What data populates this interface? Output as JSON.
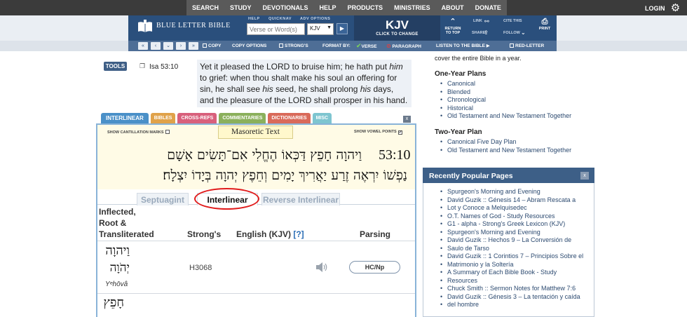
{
  "topnav": {
    "links": [
      "SEARCH",
      "STUDY",
      "DEVOTIONALS",
      "HELP",
      "PRODUCTS",
      "MINISTRIES",
      "ABOUT",
      "DONATE"
    ],
    "login": "LOGIN"
  },
  "header": {
    "logo": "BLUE LETTER BIBLE",
    "help_label": "HELP",
    "quicknav_label": "QUICKNAV",
    "adv_options_label": "ADV OPTIONS",
    "search_placeholder": "Verse or Word(s)",
    "version_selected": "KJV",
    "current_version": "KJV",
    "click_to_change": "CLICK TO CHANGE",
    "return_to_top": "RETURN TO TOP",
    "link_label": "LINK",
    "share_label": "SHARE",
    "cite_this": "CITE THIS",
    "follow_label": "FOLLOW",
    "print_label": "PRINT"
  },
  "toolstrip": {
    "copy": "COPY",
    "copy_options": "COPY OPTIONS",
    "strongs": "STRONG'S",
    "format_by": "FORMAT BY:",
    "verse": "VERSE",
    "paragraph": "PARAGRAPH",
    "listen": "LISTEN TO THE BIBLE",
    "red_letter": "RED-LETTER"
  },
  "verse": {
    "tools_label": "TOOLS",
    "reference": "Isa 53:10",
    "text_part1": "Yet it pleased the LORD to bruise him; he hath put ",
    "text_him": "him",
    "text_part2": " to grief: when thou shalt make his soul an offering for sin, he shall see ",
    "text_his1": "his",
    "text_part3": " seed, he shall prolong ",
    "text_his2": "his",
    "text_part4": " days, and the pleasure of the LORD shall prosper in his hand."
  },
  "tabs": [
    {
      "label": "INTERLINEAR",
      "color": "#4a90c8"
    },
    {
      "label": "BIBLES",
      "color": "#e0a24a"
    },
    {
      "label": "CROSS-REFS",
      "color": "#d8607c"
    },
    {
      "label": "COMMENTARIES",
      "color": "#8bb05c"
    },
    {
      "label": "DICTIONARIES",
      "color": "#d96a5a"
    },
    {
      "label": "MISC",
      "color": "#7ec5d0"
    }
  ],
  "panel": {
    "close": "x",
    "show_cantillation": "SHOW CANTILLATION MARKS",
    "show_vowel": "SHOW VOWEL POINTS",
    "masoretic_label": "Masoretic Text",
    "verse_number": "53:10",
    "hebrew_line1": "וַיהוָה חָפֵץ דַּכְּאוֹ הֶחֱלִי אִם־תָּשִׂים אָשָׁם",
    "hebrew_line2": "נַפְשׁוֹ יִרְאֶה זֶרַע יַאֲרִיךְ יָמִים וְחֵפֶץ יְהוָה בְּיָדוֹ יִצְלָח׃",
    "subtabs": [
      "Septuagint",
      "Interlinear",
      "Reverse Interlinear"
    ],
    "col_inflected": "Inflected,",
    "col_root": "Root &",
    "col_translit": "Transliterated",
    "col_strongs": "Strong's",
    "col_english": "English (KJV)",
    "col_help": "[?]",
    "col_parsing": "Parsing",
    "row1_inflected": "וַיהוָה",
    "row1_root": "יְהֹוָה",
    "row1_translit": "Yᵉhōvâ",
    "row1_strongs": "H3068",
    "row1_parsing": "HC/Np",
    "row2_inflected": "חָפֵץ"
  },
  "right": {
    "top_line": "cover the entire Bible in a year.",
    "one_year_title": "One-Year Plans",
    "one_year_items": [
      "Canonical",
      "Blended",
      "Chronological",
      "Historical",
      "Old Testament and New Testament Together"
    ],
    "two_year_title": "Two-Year Plan",
    "two_year_items": [
      "Canonical Five Day Plan",
      "Old Testament and New Testament Together"
    ],
    "popular_title": "Recently Popular Pages",
    "popular_close": "x",
    "popular_items": [
      "Spurgeon's Morning and Evening",
      "David Guzik :: Génesis 14 – Abram Rescata a",
      "Lot y Conoce a Melquisedec",
      "O.T. Names of God - Study Resources",
      "G1 - alpha - Strong's Greek Lexicon (KJV)",
      "Spurgeon's Morning and Evening",
      "David Guzik :: Hechos 9 – La Conversión de",
      "Saulo de Tarso",
      "David Guzik :: 1 Corintios 7 – Principios Sobre el",
      "Matrimonio y la Soltería",
      "A Summary of Each Bible Book - Study",
      "Resources",
      "Chuck Smith :: Sermon Notes for Matthew 7:6",
      "David Guzik :: Génesis 3 – La tentación y caída",
      "del hombre"
    ]
  }
}
